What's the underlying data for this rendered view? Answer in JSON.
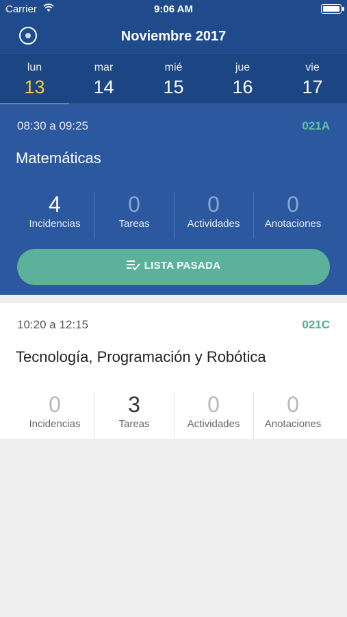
{
  "status_bar": {
    "carrier": "Carrier",
    "time": "9:06 AM"
  },
  "header": {
    "title": "Noviembre 2017"
  },
  "week": [
    {
      "name": "lun",
      "num": "13",
      "selected": true
    },
    {
      "name": "mar",
      "num": "14"
    },
    {
      "name": "mié",
      "num": "15"
    },
    {
      "name": "jue",
      "num": "16"
    },
    {
      "name": "vie",
      "num": "17"
    }
  ],
  "sessions": [
    {
      "time": "08:30 a 09:25",
      "room": "021A",
      "subject": "Matemáticas",
      "stats": [
        {
          "value": "4",
          "label": "Incidencias"
        },
        {
          "value": "0",
          "label": "Tareas"
        },
        {
          "value": "0",
          "label": "Actividades"
        },
        {
          "value": "0",
          "label": "Anotaciones"
        }
      ],
      "button_label": "LISTA PASADA"
    },
    {
      "time": "10:20 a 12:15",
      "room": "021C",
      "subject": "Tecnología, Programación y Robótica",
      "stats": [
        {
          "value": "0",
          "label": "Incidencias"
        },
        {
          "value": "3",
          "label": "Tareas"
        },
        {
          "value": "0",
          "label": "Actividades"
        },
        {
          "value": "0",
          "label": "Anotaciones"
        }
      ]
    }
  ],
  "colors": {
    "header_blue": "#1f4a8c",
    "card_blue": "#2c58a0",
    "accent_yellow": "#f2cf3c",
    "accent_green": "#5bb199"
  },
  "icons": {
    "profile": "profile-circle-icon",
    "wifi": "wifi-icon",
    "battery": "battery-icon",
    "list_check": "list-check-icon"
  }
}
